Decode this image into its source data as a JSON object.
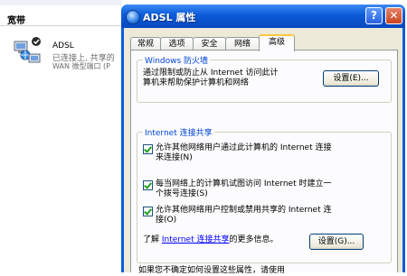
{
  "background": {
    "section_title": "宽带",
    "connection_name": "ADSL",
    "connection_status": "已连接上, 共享的",
    "connection_device": "WAN 微型端口 (P"
  },
  "dialog": {
    "title": "ADSL 属性",
    "help_button": "?",
    "close_button": "✕",
    "tabs": [
      "常规",
      "选项",
      "安全",
      "网络",
      "高级"
    ],
    "active_tab": "高级",
    "firewall": {
      "group_title": "Windows 防火墙",
      "description_line1": "通过限制或防止从 Internet 访问此计",
      "description_line2": "算机来帮助保护计算机和网络",
      "settings_button": "设置(E)..."
    },
    "ics": {
      "group_title": "Internet 连接共享",
      "option1_line1": "允许其他网络用户通过此计算机的 Internet 连接",
      "option1_line2": "来连接(N)",
      "option2_line1": "每当网络上的计算机试图访问 Internet 时建立一",
      "option2_line2": "个拨号连接(S)",
      "option3_line1": "允许其他网络用户控制或禁用共享的 Internet 连",
      "option3_line2": "接(O)",
      "learn_prefix": "了解",
      "learn_link": "Internet 连接共享",
      "learn_suffix": "的更多信息。",
      "settings_button": "设置(G)..."
    },
    "footer_text": "如果您不确定如何设置这些属性，请使用"
  }
}
